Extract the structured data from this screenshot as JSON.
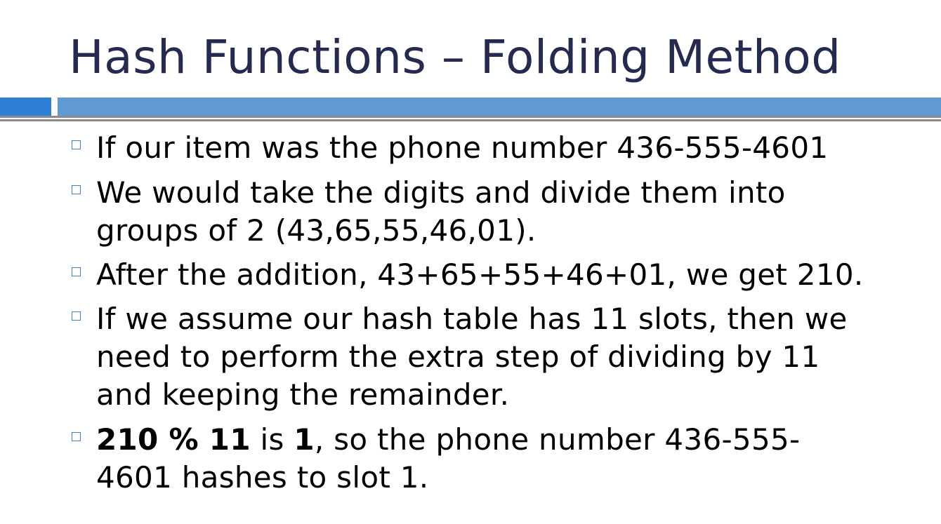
{
  "slide": {
    "title": "Hash Functions – Folding Method",
    "colors": {
      "title": "#252a50",
      "bar_left": "#2e7fd6",
      "bar_right": "#5f9bd2",
      "rule": "#8c8c8c",
      "bullet_marker": "#3b7fc4"
    },
    "bullets": [
      {
        "text": "If our item was the phone number 436-555-4601"
      },
      {
        "line1": "We would take the digits and divide them into",
        "line2": "groups of 2 (43,65,55,46,01)."
      },
      {
        "text": "After the addition, 43+65+55+46+01, we get 210."
      },
      {
        "line1": "If we assume our hash table has 11 slots, then we",
        "line2": "need to perform the extra step of dividing by 11",
        "line3": "and keeping the remainder."
      },
      {
        "bold1": "210 % 11",
        "mid1": " is ",
        "bold2": "1",
        "rest1": ", so the phone number 436-555-",
        "line2": "4601 hashes to slot 1."
      }
    ]
  }
}
